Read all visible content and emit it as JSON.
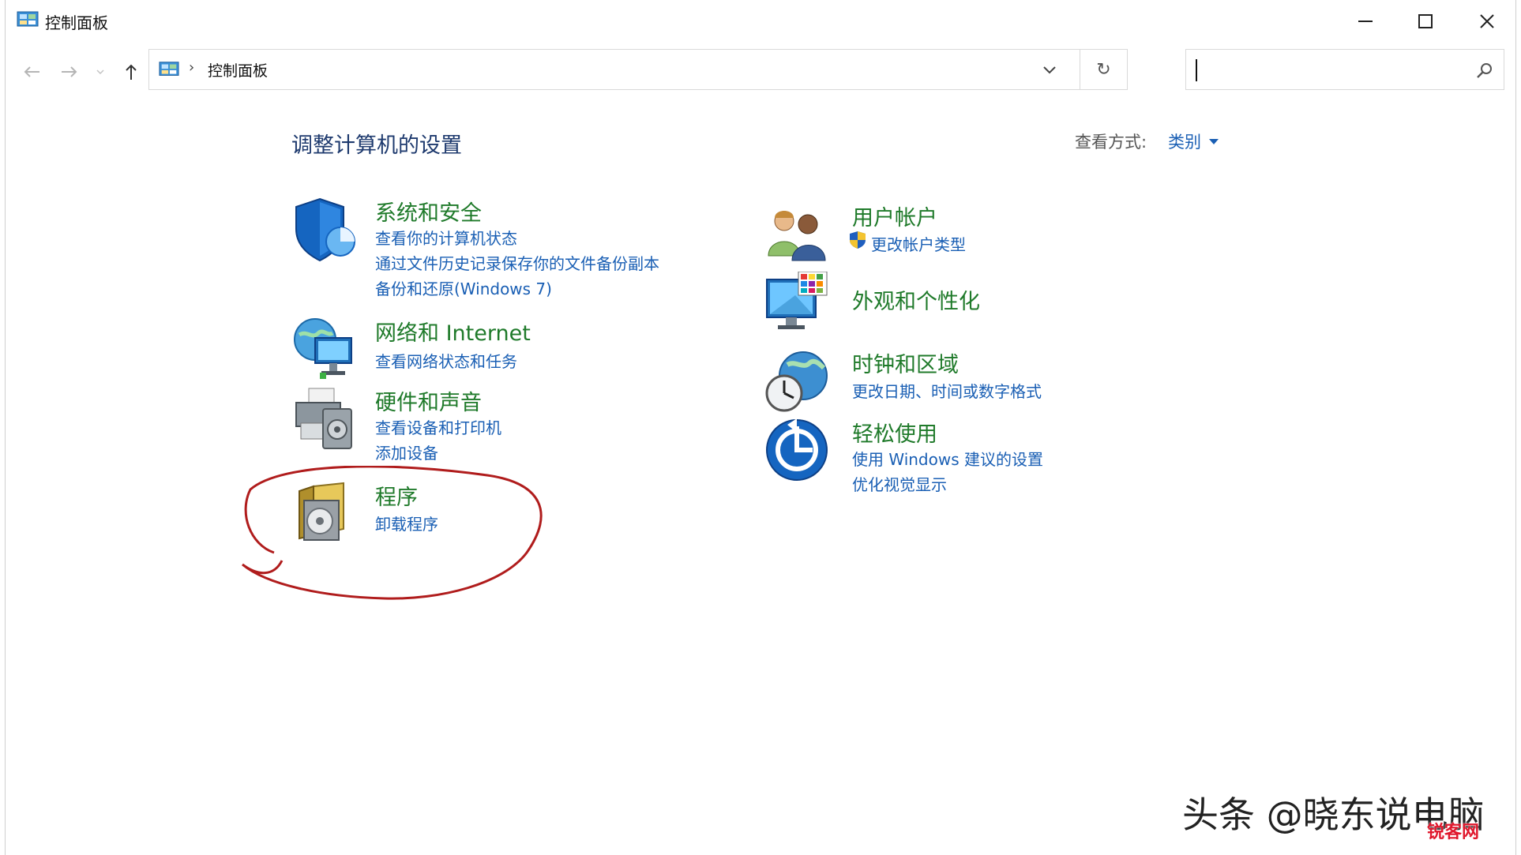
{
  "window": {
    "title": "控制面板"
  },
  "address": {
    "separator": "›",
    "path": "控制面板",
    "refresh_glyph": "↻"
  },
  "search": {
    "value": "",
    "placeholder": ""
  },
  "main": {
    "title": "调整计算机的设置",
    "view_by_label": "查看方式:",
    "view_by_value": "类别"
  },
  "categories": {
    "system_security": {
      "title": "系统和安全",
      "links": [
        "查看你的计算机状态",
        "通过文件历史记录保存你的文件备份副本",
        "备份和还原(Windows 7)"
      ]
    },
    "network": {
      "title": "网络和 Internet",
      "links": [
        "查看网络状态和任务"
      ]
    },
    "hardware": {
      "title": "硬件和声音",
      "links": [
        "查看设备和打印机",
        "添加设备"
      ]
    },
    "programs": {
      "title": "程序",
      "links": [
        "卸载程序"
      ]
    },
    "user_accounts": {
      "title": "用户帐户",
      "links": [
        "更改帐户类型"
      ]
    },
    "appearance": {
      "title": "外观和个性化",
      "links": []
    },
    "clock_region": {
      "title": "时钟和区域",
      "links": [
        "更改日期、时间或数字格式"
      ]
    },
    "ease_access": {
      "title": "轻松使用",
      "links": [
        "使用 Windows 建议的设置",
        "优化视觉显示"
      ]
    }
  },
  "watermark": {
    "text": "头条 @晓东说电脑",
    "badge": "锐客网"
  },
  "colors": {
    "category_title": "#1f7a2a",
    "link": "#1a5fb4",
    "heading": "#1e3a6e",
    "annotation": "#b01c1c"
  }
}
